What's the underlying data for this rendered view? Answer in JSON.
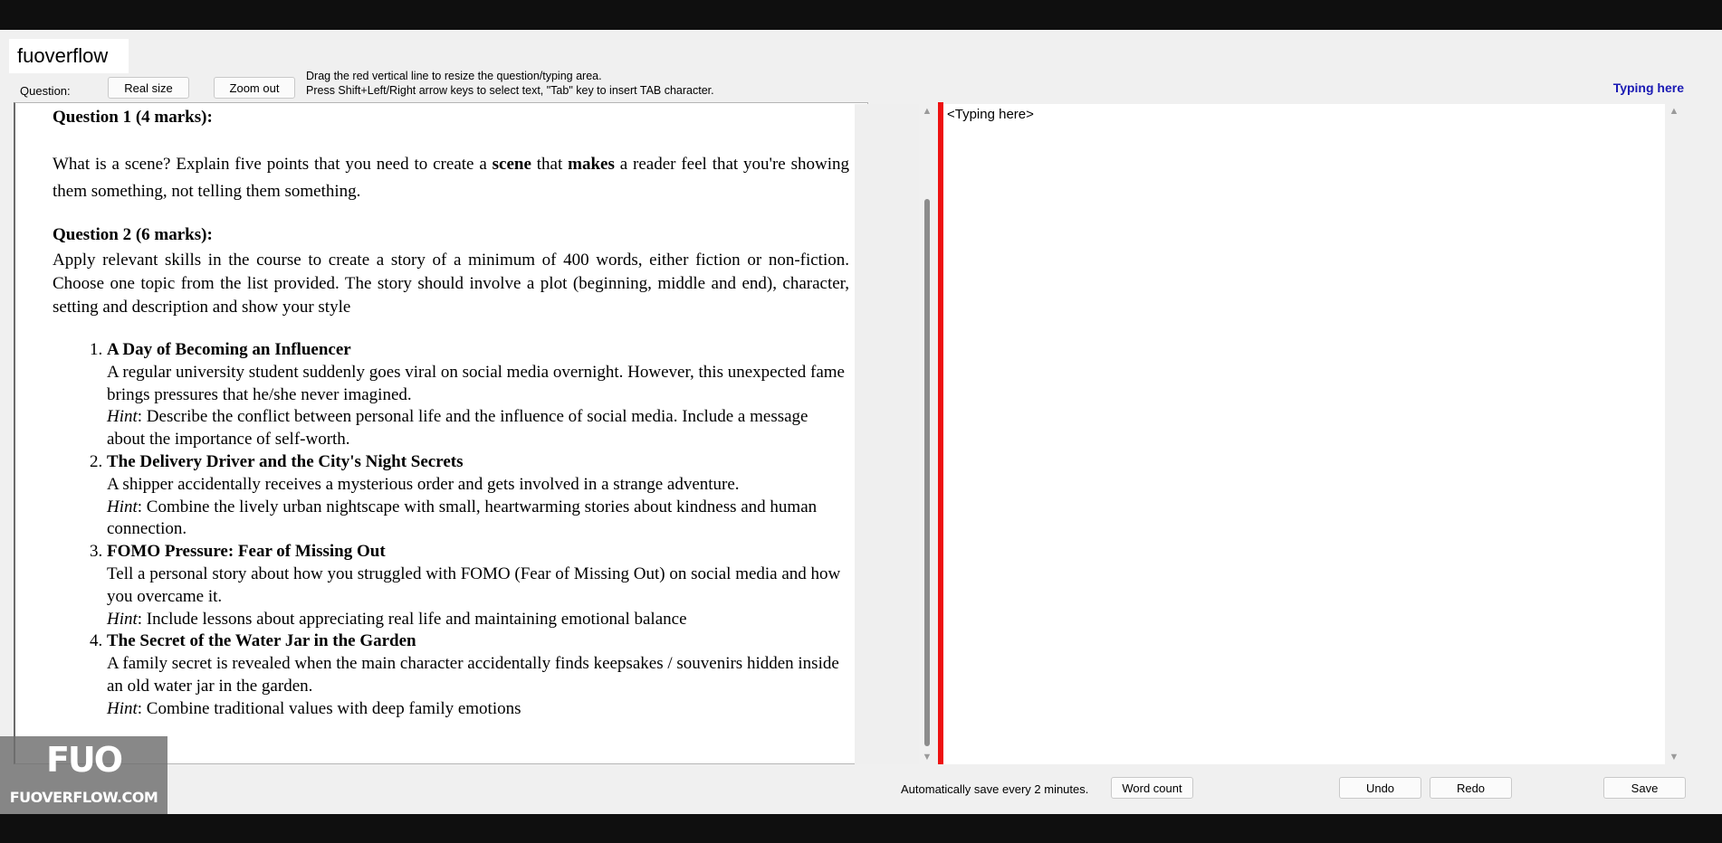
{
  "app": {
    "title": "fuoverflow"
  },
  "toolbar": {
    "question_label": "Question:",
    "real_size_label": "Real size",
    "zoom_out_label": "Zoom out",
    "hint_line1": "Drag the red vertical line to resize the question/typing area.",
    "hint_line2": "Press Shift+Left/Right arrow keys to select text, \"Tab\" key to insert TAB character.",
    "typing_here_label": "Typing here"
  },
  "question": {
    "q1_heading": "Question 1 (4 marks):",
    "q1_text_a": "What is a scene? Explain five points that you need to create a ",
    "q1_bold_scene": "scene",
    "q1_text_b": " that ",
    "q1_bold_makes": "makes",
    "q1_text_c": " a reader feel that you're showing them something, not telling them something.",
    "q2_heading": "Question 2 (6 marks):",
    "q2_text": "Apply relevant skills in the course to create a story of a minimum of 400 words, either fiction or non-fiction. Choose one topic from the list provided. The story should involve a plot (beginning, middle and end), character, setting and description and show your style",
    "hint_word": "Hint",
    "topics": [
      {
        "title": "A Day of Becoming an Influencer",
        "desc": "A regular university student suddenly goes viral on social media overnight. However, this unexpected fame brings pressures that he/she never imagined.",
        "hint": ": Describe the conflict between personal life and the influence of social media. Include a message about the importance of self-worth."
      },
      {
        "title": "The Delivery Driver and the City's Night Secrets",
        "desc": "A shipper accidentally receives a mysterious order and gets involved in a strange adventure.",
        "hint": ": Combine the lively urban nightscape with small, heartwarming stories about kindness and human connection."
      },
      {
        "title": "FOMO Pressure: Fear of Missing Out",
        "desc": "Tell a personal story about how you struggled with FOMO (Fear of Missing Out) on social media and how you overcame it.",
        "hint": ": Include lessons about appreciating real life and maintaining emotional balance"
      },
      {
        "title": "The Secret of the Water Jar in the Garden",
        "desc": "A family secret is revealed when the main character accidentally finds keepsakes / souvenirs hidden inside an old water jar in the garden.",
        "hint": ": Combine traditional values with deep family emotions"
      }
    ]
  },
  "typing": {
    "placeholder": "<Typing here>"
  },
  "status": {
    "autosave_text": "Automatically save every 2 minutes.",
    "word_count_label": "Word count",
    "undo_label": "Undo",
    "redo_label": "Redo",
    "save_label": "Save"
  },
  "watermark": {
    "mark": "FUO",
    "site": "FUOVERFLOW.COM"
  },
  "colors": {
    "splitter": "#ee1111",
    "typing_label": "#1a1ab4"
  }
}
